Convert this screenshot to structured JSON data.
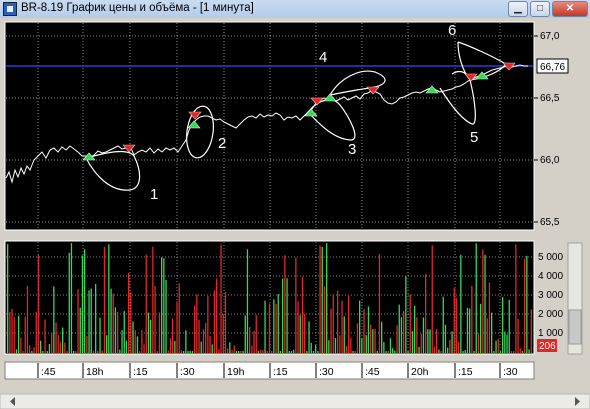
{
  "window": {
    "title": "BR-8.19 График цены и объёма - [1 минута]",
    "buttons": {
      "minimize": "▁",
      "maximize": "□",
      "close": "✕"
    }
  },
  "price_panel": {
    "y_ticks": [
      "67,0",
      "66,5",
      "66,0",
      "65,5"
    ],
    "current_price": "66,76",
    "annotations": [
      "1",
      "2",
      "3",
      "4",
      "5",
      "6"
    ],
    "colors": {
      "buy": "#39d65a",
      "sell": "#e02828",
      "price_line": "#ffffff",
      "level_line": "#2b3bd6",
      "background": "#000000"
    }
  },
  "volume_panel": {
    "y_ticks": [
      "5 000",
      "4 000",
      "3 000",
      "2 000",
      "1 000"
    ],
    "current_volume": "206"
  },
  "time_axis": {
    "labels": [
      ":45",
      "18h",
      ":15",
      ":30",
      "19h",
      ":15",
      ":30",
      ":45",
      "20h",
      ":15",
      ":30"
    ]
  }
}
